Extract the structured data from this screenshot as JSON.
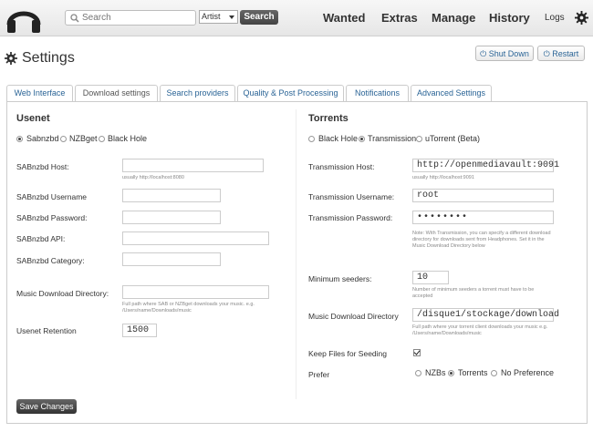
{
  "header": {
    "search_placeholder": "Search",
    "search_type": "Artist",
    "search_button": "Search",
    "nav": [
      "Wanted",
      "Extras",
      "Manage",
      "History"
    ],
    "logs": "Logs"
  },
  "page": {
    "title": "Settings",
    "shutdown": "Shut Down",
    "restart": "Restart"
  },
  "tabs": [
    "Web Interface",
    "Download settings",
    "Search providers",
    "Quality & Post Processing",
    "Notifications",
    "Advanced Settings"
  ],
  "usenet": {
    "title": "Usenet",
    "options": [
      "Sabnzbd",
      "NZBget",
      "Black Hole"
    ],
    "selected": "Sabnzbd",
    "fields": {
      "host": {
        "label": "SABnzbd Host:",
        "value": "",
        "hint": "usually http://localhost:8080"
      },
      "username": {
        "label": "SABnzbd Username",
        "value": ""
      },
      "password": {
        "label": "SABnzbd Password:",
        "value": ""
      },
      "api": {
        "label": "SABnzbd API:",
        "value": ""
      },
      "category": {
        "label": "SABnzbd Category:",
        "value": ""
      },
      "music_dir": {
        "label": "Music Download Directory:",
        "value": "",
        "hint1": "Full path where SAB or NZBget downloads your music. e.g.",
        "hint2": "/Users/name/Downloads/music"
      },
      "retention": {
        "label": "Usenet Retention",
        "value": "1500"
      }
    }
  },
  "torrents": {
    "title": "Torrents",
    "options": [
      "Black Hole",
      "Transmission",
      "uTorrent (Beta)"
    ],
    "selected": "Transmission",
    "fields": {
      "host": {
        "label": "Transmission Host:",
        "value": "http://openmediavault:9091",
        "hint": "usually http://localhost:9091"
      },
      "username": {
        "label": "Transmission Username:",
        "value": "root"
      },
      "password": {
        "label": "Transmission Password:",
        "value": "••••••••",
        "hint1": "Note: With Transmission, you can specify a different download",
        "hint2": "directory for downloads sent from Headphones. Set it in the",
        "hint3": "Music Download Directory below"
      },
      "min_seeders": {
        "label": "Minimum seeders:",
        "value": "10",
        "hint1": "Number of minimum seeders a torrent must have to be",
        "hint2": "accepted"
      },
      "music_dir": {
        "label": "Music Download Directory",
        "value": "/disque1/stockage/download",
        "hint1": "Full path where your torrent client downloads your music e.g.",
        "hint2": "/Users/name/Downloads/music"
      },
      "keep_files": {
        "label": "Keep Files for Seeding",
        "checked": true
      },
      "prefer": {
        "label": "Prefer",
        "options": [
          "NZBs",
          "Torrents",
          "No Preference"
        ],
        "selected": "Torrents"
      }
    }
  },
  "save_button": "Save Changes"
}
